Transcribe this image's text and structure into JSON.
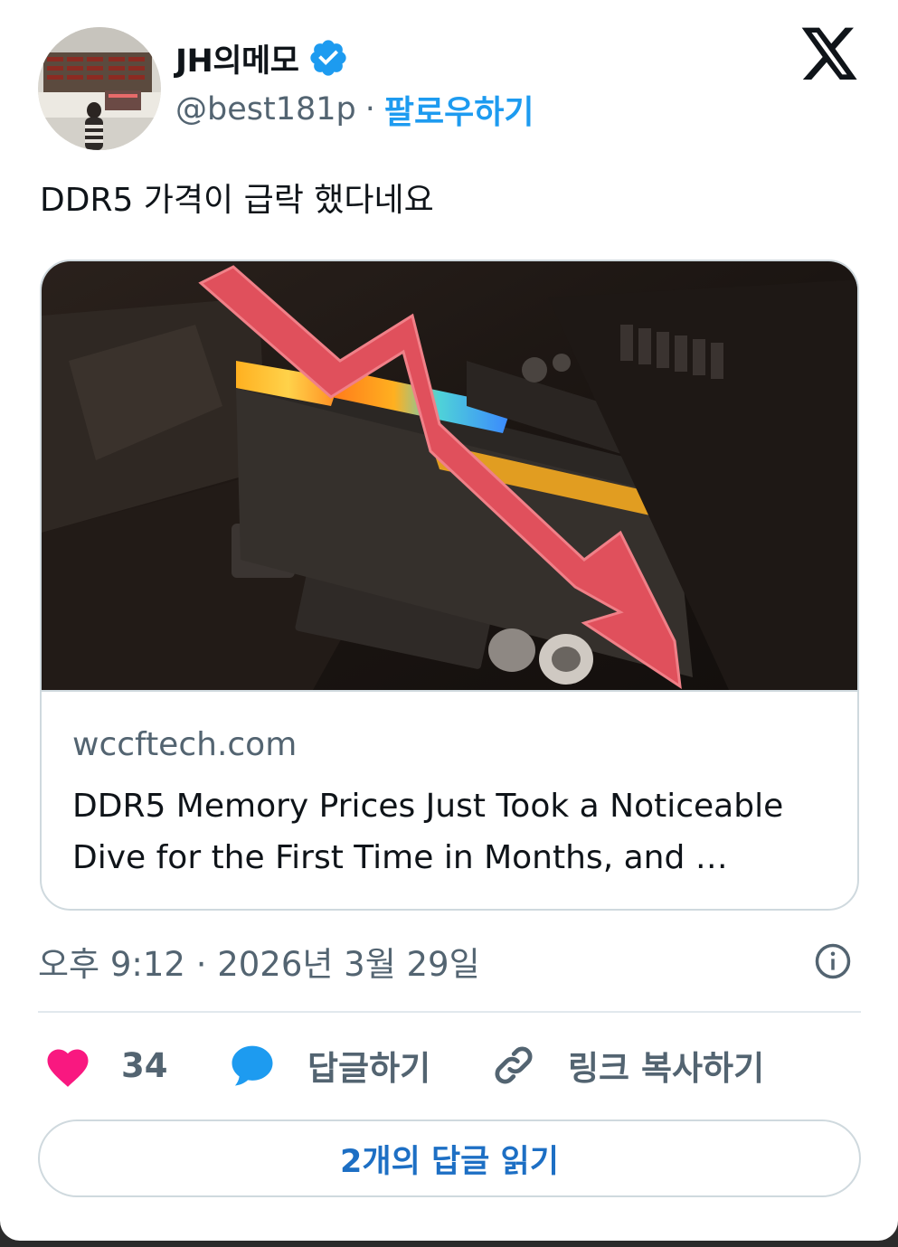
{
  "author": {
    "display_name": "JH의메모",
    "handle": "@best181p",
    "separator": "·",
    "follow_label": "팔로우하기",
    "verified": true
  },
  "tweet": {
    "text": "DDR5 가격이 급락 했다네요"
  },
  "link_card": {
    "domain": "wccftech.com",
    "title_line1": "DDR5 Memory Prices Just Took a Noticeable",
    "title_line2": "Dive for the First Time in Months, and …",
    "image_colors": {
      "background": "#1b1512",
      "arrow": "#e0505c"
    }
  },
  "meta": {
    "timestamp": "오후 9:12 · 2026년 3월 29일"
  },
  "actions": {
    "like_count": "34",
    "reply_label": "답글하기",
    "copy_link_label": "링크 복사하기"
  },
  "read_replies_label": "2개의 답글 읽기",
  "colors": {
    "accent": "#1d9bf0",
    "like": "#f91880",
    "secondary_text": "#536471",
    "border": "#cfd9de"
  },
  "icons": {
    "verified": "verified-badge-icon",
    "x_logo": "x-logo-icon",
    "info": "info-icon",
    "heart": "heart-icon",
    "reply": "reply-bubble-icon",
    "link": "link-icon"
  }
}
